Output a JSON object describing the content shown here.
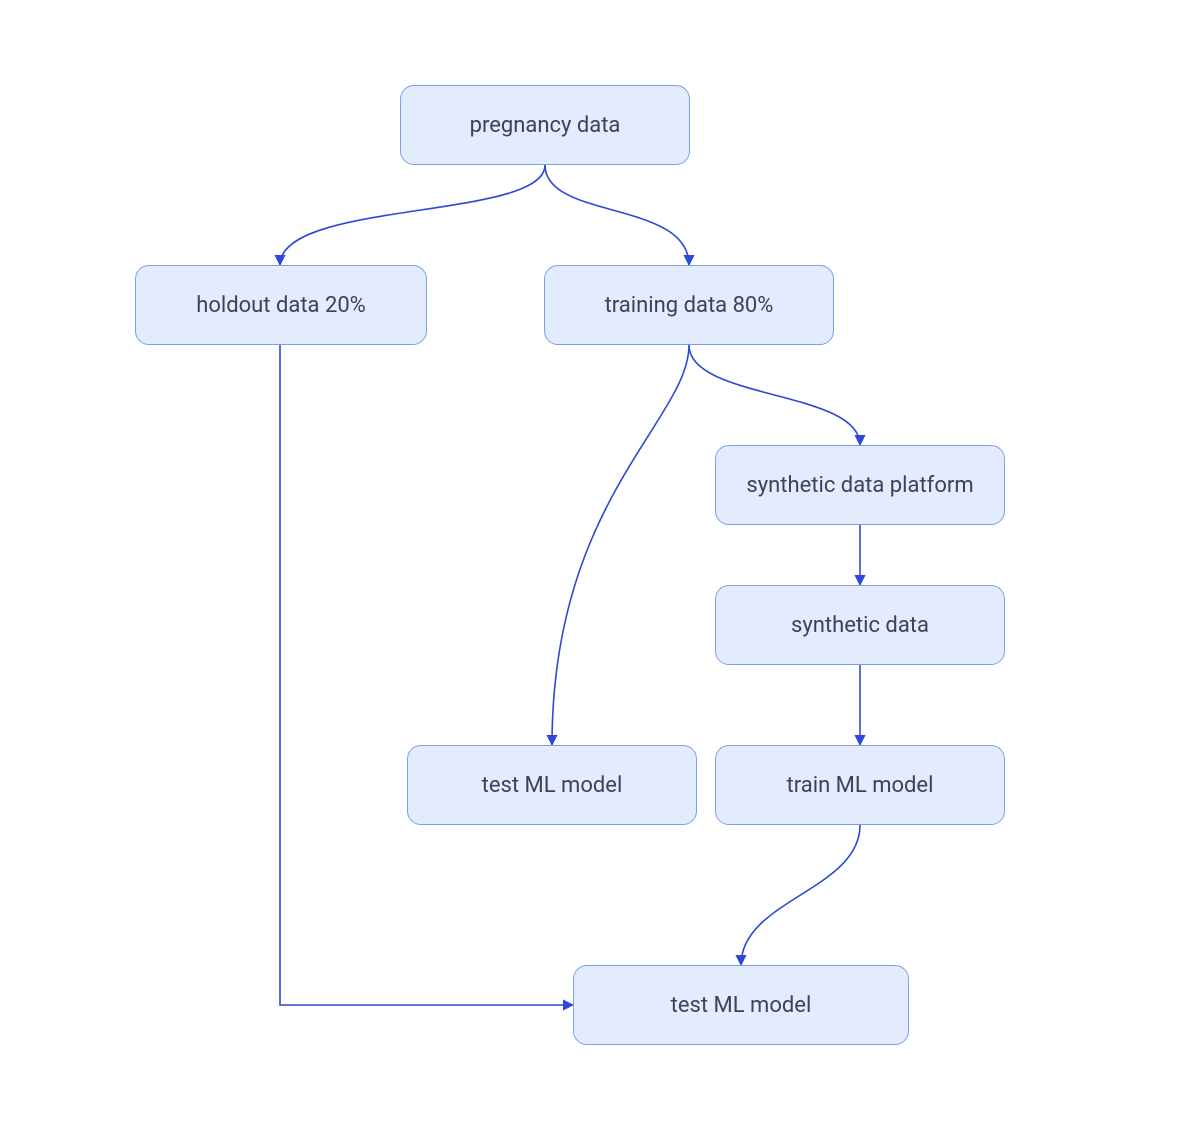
{
  "nodes": {
    "pregnancy": "pregnancy data",
    "holdout": "holdout data 20%",
    "training": "training data 80%",
    "platform": "synthetic data platform",
    "synth": "synthetic data",
    "test1": "test ML model",
    "train": "train ML model",
    "test2": "test ML model"
  },
  "edges": [
    {
      "from": "pregnancy",
      "to": "holdout"
    },
    {
      "from": "pregnancy",
      "to": "training"
    },
    {
      "from": "training",
      "to": "test1"
    },
    {
      "from": "training",
      "to": "platform"
    },
    {
      "from": "platform",
      "to": "synth"
    },
    {
      "from": "synth",
      "to": "train"
    },
    {
      "from": "train",
      "to": "test2"
    },
    {
      "from": "holdout",
      "to": "test2"
    }
  ],
  "style": {
    "node_fill": "#e3ecfc",
    "node_stroke": "#7ca0e8",
    "edge_stroke": "#2b49d6",
    "text_color": "#3a4455"
  }
}
